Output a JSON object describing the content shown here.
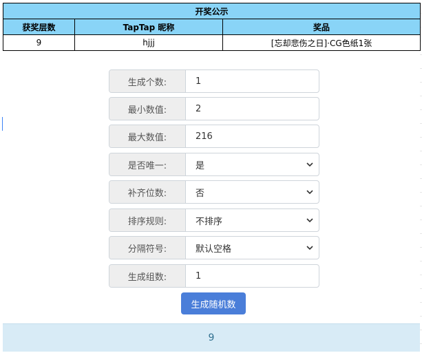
{
  "table": {
    "title": "开奖公示",
    "columns": [
      "获奖层数",
      "TapTap 昵称",
      "奖品"
    ],
    "rows": [
      {
        "floor": "9",
        "nickname": "hjjj",
        "prize": "[忘却悲伤之日]·CG色纸1张"
      }
    ]
  },
  "form": {
    "count": {
      "label": "生成个数:",
      "value": "1"
    },
    "min": {
      "label": "最小数值:",
      "value": "2"
    },
    "max": {
      "label": "最大数值:",
      "value": "216"
    },
    "unique": {
      "label": "是否唯一:",
      "value": "是"
    },
    "pad": {
      "label": "补齐位数:",
      "value": "否"
    },
    "sort": {
      "label": "排序规则:",
      "value": "不排序"
    },
    "separator": {
      "label": "分隔符号:",
      "value": "默认空格"
    },
    "groups": {
      "label": "生成组数:",
      "value": "1"
    }
  },
  "generate_button": "生成随机数",
  "result": "9",
  "colors": {
    "header_bg": "#89d4f7",
    "button_bg": "#4a7ed9",
    "result_bg": "#d8ebf6"
  },
  "icons": {
    "dropdown": "chevron-down-icon"
  }
}
